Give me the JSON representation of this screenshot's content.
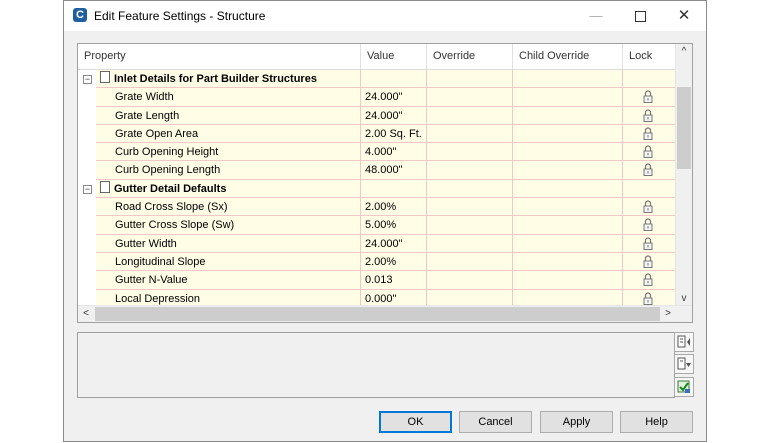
{
  "window": {
    "app_icon": "C",
    "title": "Edit Feature Settings - Structure"
  },
  "grid": {
    "columns": [
      "Property",
      "Value",
      "Override",
      "Child Override",
      "Lock"
    ],
    "rows": [
      {
        "type": "group",
        "expander": "−",
        "label": "Inlet Details for Part Builder Structures"
      },
      {
        "type": "item",
        "label": "Grate Width",
        "value": "24.000\""
      },
      {
        "type": "item",
        "label": "Grate Length",
        "value": "24.000\""
      },
      {
        "type": "item",
        "label": "Grate Open Area",
        "value": "2.00 Sq. Ft."
      },
      {
        "type": "item",
        "label": "Curb Opening Height",
        "value": "4.000\""
      },
      {
        "type": "item",
        "label": "Curb Opening Length",
        "value": "48.000\""
      },
      {
        "type": "group",
        "expander": "−",
        "label": "Gutter Detail Defaults"
      },
      {
        "type": "item",
        "label": "Road Cross Slope (Sx)",
        "value": "2.00%"
      },
      {
        "type": "item",
        "label": "Gutter Cross Slope (Sw)",
        "value": "5.00%"
      },
      {
        "type": "item",
        "label": "Gutter Width",
        "value": "24.000\""
      },
      {
        "type": "item",
        "label": "Longitudinal Slope",
        "value": "2.00%"
      },
      {
        "type": "item",
        "label": "Gutter N-Value",
        "value": "0.013"
      },
      {
        "type": "item",
        "label": "Local Depression",
        "value": "0.000\""
      }
    ],
    "scroll_up": "^",
    "scroll_down": "v",
    "scroll_left": "<",
    "scroll_right": ">"
  },
  "buttons": {
    "ok": "OK",
    "cancel": "Cancel",
    "apply": "Apply",
    "help": "Help"
  },
  "icons": {
    "lock": "lock-icon",
    "side_buttons": [
      "expand-collapse-icon",
      "filter-icon",
      "check-settings-icon"
    ]
  },
  "colors": {
    "cell_bg": "#fffde6",
    "cell_border": "#f0c8c8",
    "default_button_border": "#0078d7"
  }
}
